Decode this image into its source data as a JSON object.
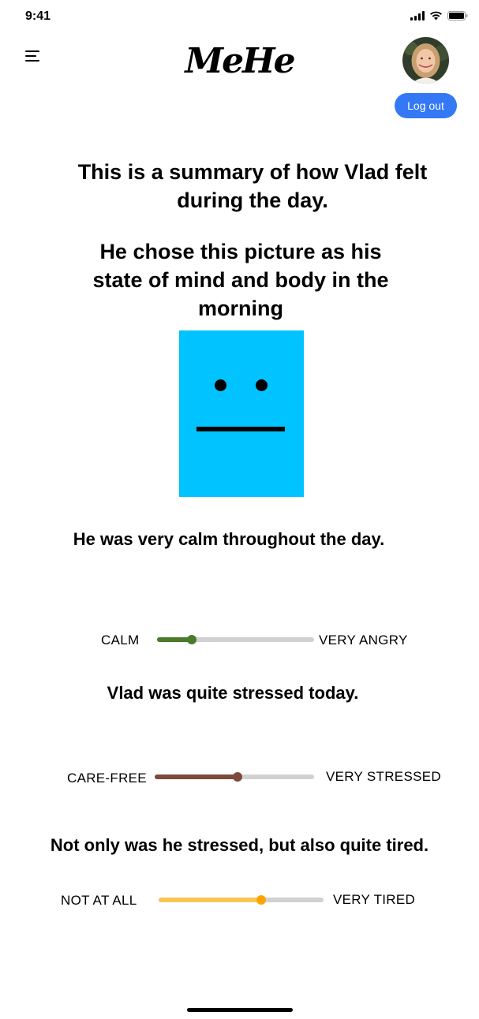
{
  "status_bar": {
    "time": "9:41"
  },
  "header": {
    "logo": "MeHe",
    "logout_label": "Log out"
  },
  "content": {
    "summary_text": "This is a summary of how Vlad felt during the day.",
    "picture_text": "He chose this picture as his state of mind and body in the morning",
    "mood_face_color": "#00c3ff",
    "calm_text": "He was very calm throughout the day.",
    "stressed_text": "Vlad was quite stressed today.",
    "tired_text": "Not only was he stressed, but also quite tired."
  },
  "sliders": [
    {
      "min_label": "CALM",
      "max_label": "VERY ANGRY",
      "value": 0.22,
      "color": "#4a7a2a"
    },
    {
      "min_label": "CARE-FREE",
      "max_label": "VERY STRESSED",
      "value": 0.52,
      "color": "#7e4a3c"
    },
    {
      "min_label": "NOT AT ALL",
      "max_label": "VERY TIRED",
      "value": 0.62,
      "color": "#f9c455",
      "thumb_color": "#ffa500"
    }
  ]
}
